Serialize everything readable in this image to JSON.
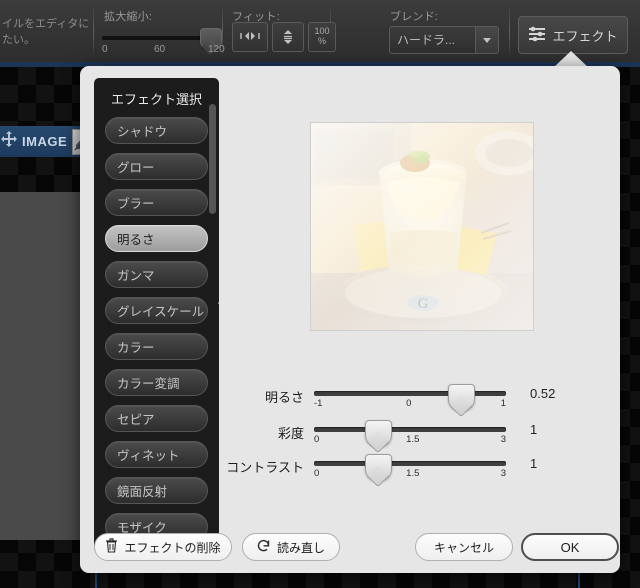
{
  "toolbar": {
    "hint_line1": "イルをエディタに",
    "hint_line2": "たい。",
    "zoom_label": "拡大縮小:",
    "zoom_ticks": [
      "0",
      "60",
      "120"
    ],
    "fit_label": "フィット:",
    "fit_horizontal_icon": "arrows-horizontal-icon",
    "fit_vertical_icon": "arrows-vertical-icon",
    "fit_100_value": "100",
    "fit_100_unit": "%",
    "blend_label": "ブレンド:",
    "blend_value": "ハードラ...",
    "blend_chevron_icon": "chevron-down-icon",
    "effect_button_label": "エフェクト",
    "effect_button_icon": "sliders-icon"
  },
  "canvas": {
    "layer_name": "IMAGE",
    "layer_move_icon": "move-cross-icon",
    "layer_edit_icon": "pencil-checkbox-icon"
  },
  "dialog": {
    "list_title": "エフェクト選択",
    "effects": [
      {
        "label": "シャドウ",
        "selected": false
      },
      {
        "label": "グロー",
        "selected": false
      },
      {
        "label": "ブラー",
        "selected": false
      },
      {
        "label": "明るさ",
        "selected": true
      },
      {
        "label": "ガンマ",
        "selected": false
      },
      {
        "label": "グレイスケール",
        "selected": false
      },
      {
        "label": "カラー",
        "selected": false
      },
      {
        "label": "カラー変調",
        "selected": false
      },
      {
        "label": "セピア",
        "selected": false
      },
      {
        "label": "ヴィネット",
        "selected": false
      },
      {
        "label": "鏡面反射",
        "selected": false
      },
      {
        "label": "モザイク",
        "selected": false
      }
    ],
    "sliders": [
      {
        "label": "明るさ",
        "value": "0.52",
        "min": "-1",
        "mid": "0",
        "max": "1",
        "pos_pct": 76
      },
      {
        "label": "彩度",
        "value": "1",
        "min": "0",
        "mid": "1.5",
        "max": "3",
        "pos_pct": 33
      },
      {
        "label": "コントラスト",
        "value": "1",
        "min": "0",
        "mid": "1.5",
        "max": "3",
        "pos_pct": 33
      }
    ],
    "footer": {
      "delete_label": "エフェクトの削除",
      "delete_icon": "trash-icon",
      "reload_label": "読み直し",
      "reload_icon": "refresh-icon",
      "cancel_label": "キャンセル",
      "ok_label": "OK"
    }
  },
  "colors": {
    "dialog_bg": "#e6e6e6",
    "list_bg": "#1c1c1c",
    "accent_blue": "#26496f",
    "toolbar_bg": "#343434"
  }
}
